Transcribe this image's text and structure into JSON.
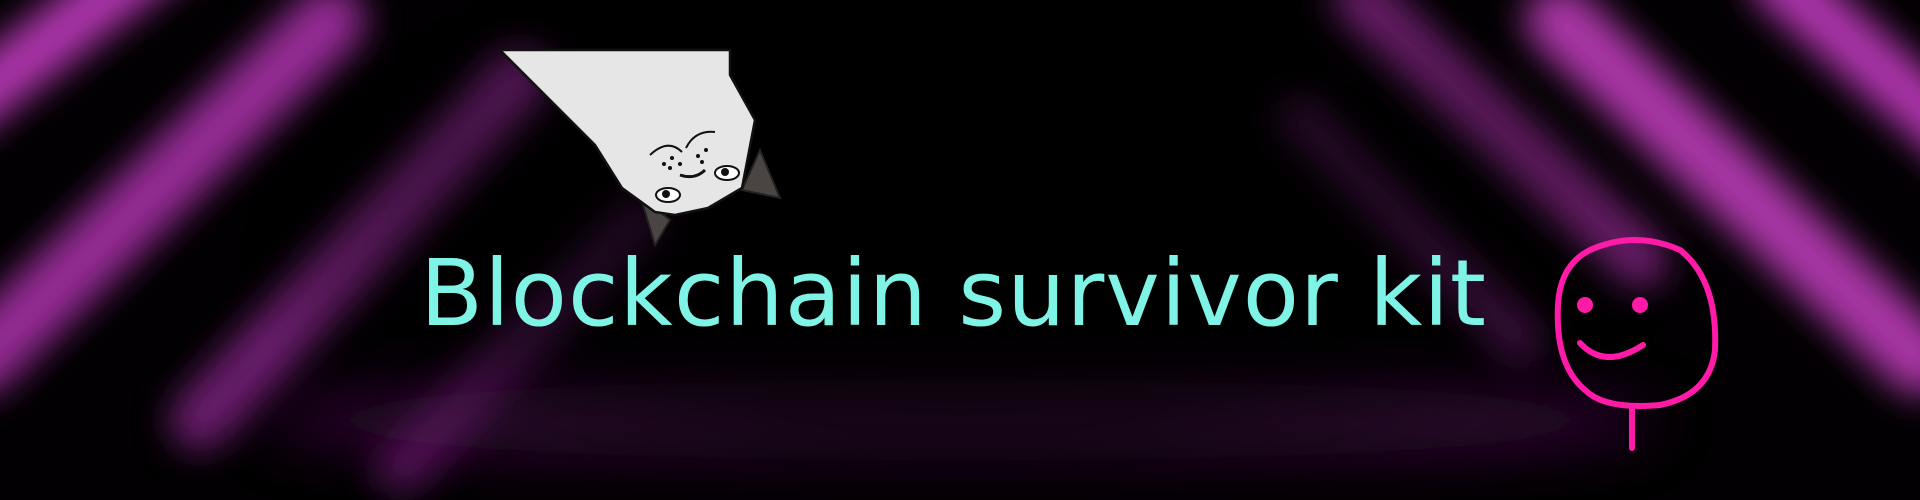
{
  "banner": {
    "title": "Blockchain survivor kit"
  },
  "colors": {
    "title": "#7ff3e6",
    "neon": "#c23cc0",
    "smiley": "#ff1aa8",
    "background": "#020002"
  },
  "icons": {
    "mascot": "upside-down-cat-icon",
    "smiley": "smiley-lollipop-icon"
  }
}
